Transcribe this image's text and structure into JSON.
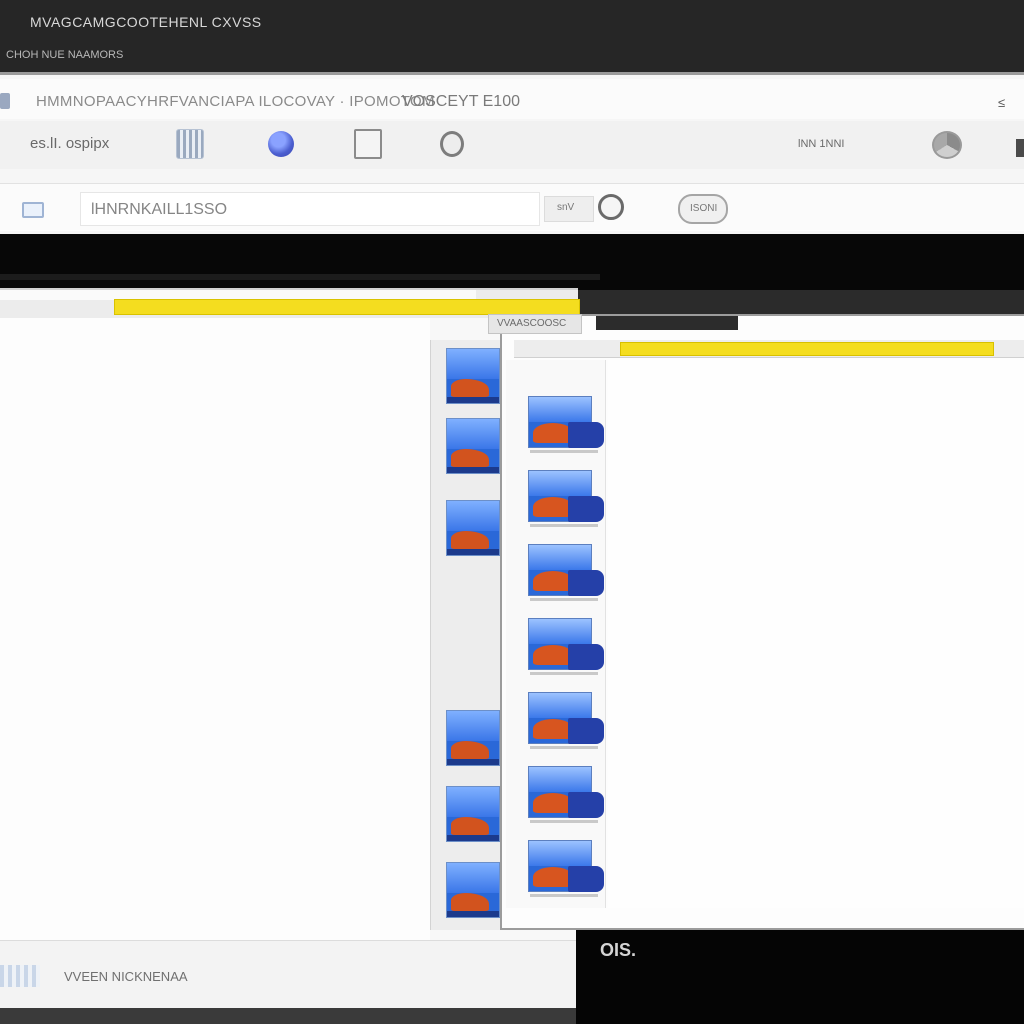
{
  "titlebar": {
    "title": "MVAGCAMGCOOTEHENL CXVSS",
    "subtitle": "CHOH NUE NAAMORS"
  },
  "address_bar": {
    "url": "HMMNOPAACYHRFVANCIAPA ILOCOVAY · IPOMOTOM",
    "url_end": "VOSCEYT E100",
    "corner_glyph": "≤"
  },
  "toolbar": {
    "label": "es.lI. ospipx",
    "right_label": "lNN  1NNI"
  },
  "search": {
    "value": "lHNRNKAILL1SSO",
    "option_label": "snV",
    "pill_label": "ISONI"
  },
  "left_window": {
    "status_text": "VVEEN NICKNENAA"
  },
  "right_window": {
    "header_label": "VVAASCOOSC"
  },
  "bottom": {
    "label": "OIS."
  },
  "icons": {
    "grid": "grid-icon",
    "globe": "globe-icon",
    "page": "page-icon",
    "settings": "gear-icon",
    "browser": "browser-icon",
    "search": "search-icon"
  },
  "colors": {
    "accent_yellow": "#f4dd1f",
    "thumbnail_blue": "#2a68d8",
    "thumbnail_orange": "#d2531e",
    "dark_background": "#070707"
  }
}
